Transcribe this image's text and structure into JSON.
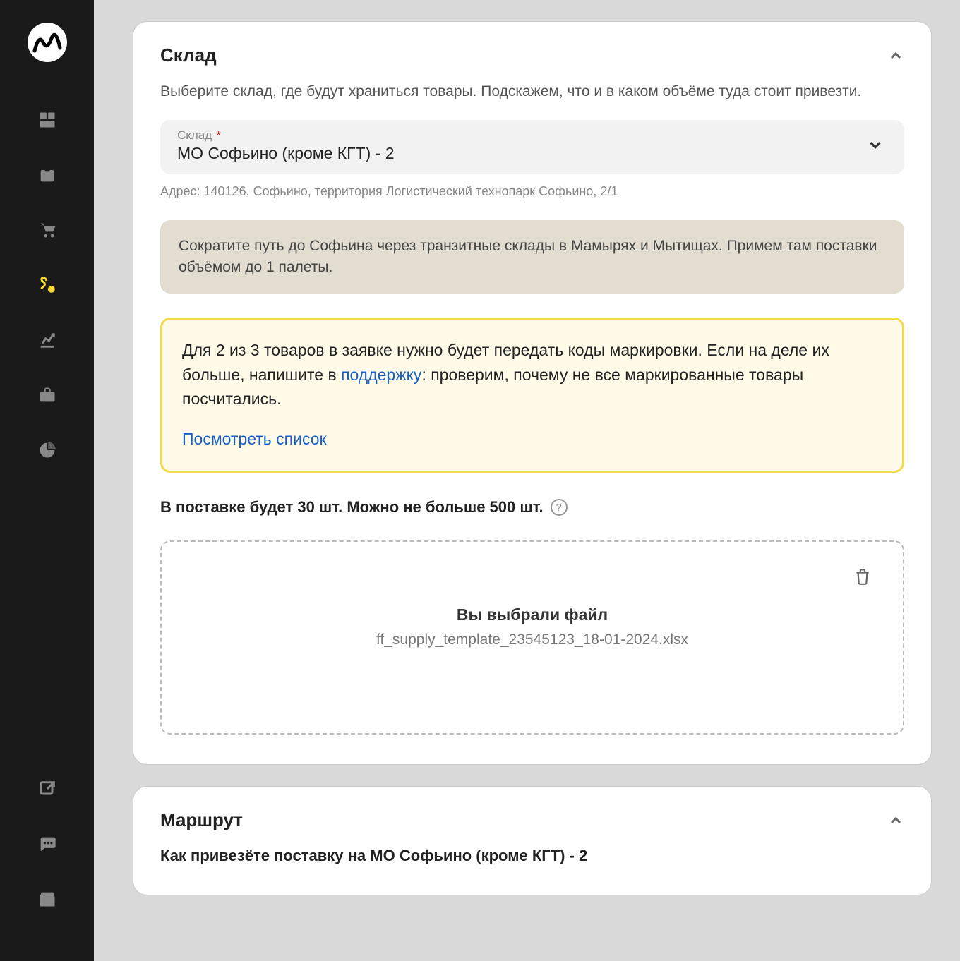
{
  "sidebar": {
    "icons": [
      "dashboard",
      "box",
      "cart",
      "route",
      "chart",
      "briefcase",
      "pie"
    ],
    "bottom_icons": [
      "external-link",
      "chat",
      "store"
    ]
  },
  "warehouse_card": {
    "title": "Склад",
    "subtitle": "Выберите склад, где будут храниться товары. Подскажем, что и в каком объёме туда стоит привезти.",
    "select_label": "Склад",
    "select_required": "*",
    "select_value": "МО Софьино (кроме КГТ) - 2",
    "address": "Адрес: 140126, Софьино, территория Логистический технопарк Софьино, 2/1",
    "transit_info": "Сократите путь до Софьина через транзитные склады в Мамырях и Мытищах. Примем там поставки объёмом до 1 палеты.",
    "highlight": {
      "text_part1": "Для 2 из 3 товаров в заявке нужно будет передать коды маркировки. Если на деле их больше, напишите в ",
      "link_text": "поддержку",
      "text_part2": ":  проверим, почему не все маркированные товары посчитались.",
      "cta": "Посмотреть список"
    },
    "stock_summary": "В поставке будет 30 шт. Можно не больше 500 шт.",
    "dropzone": {
      "title": "Вы выбрали файл",
      "filename": "ff_supply_template_23545123_18-01-2024.xlsx"
    }
  },
  "route_card": {
    "title": "Маршрут",
    "question": "Как привезёте поставку на МО Софьино (кроме КГТ) - 2"
  }
}
